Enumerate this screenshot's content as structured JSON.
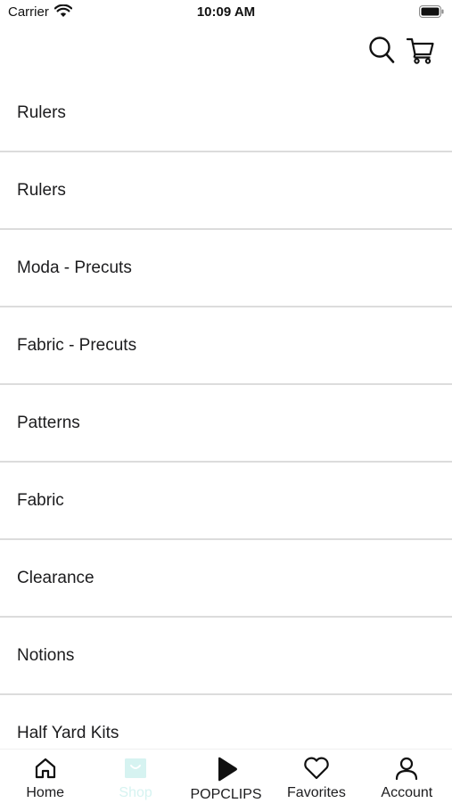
{
  "status_bar": {
    "carrier": "Carrier",
    "time": "10:09 AM"
  },
  "header": {
    "icons": [
      "search-icon",
      "cart-icon"
    ]
  },
  "categories": [
    {
      "label": "Rulers"
    },
    {
      "label": "Rulers"
    },
    {
      "label": "Moda - Precuts"
    },
    {
      "label": "Fabric - Precuts"
    },
    {
      "label": "Patterns"
    },
    {
      "label": "Fabric"
    },
    {
      "label": "Clearance"
    },
    {
      "label": "Notions"
    },
    {
      "label": "Half Yard Kits"
    }
  ],
  "tab_bar": {
    "tabs": [
      {
        "label": "Home",
        "icon": "home-icon"
      },
      {
        "label": "Shop",
        "icon": "shop-icon",
        "active": true
      },
      {
        "label": "POPCLIPS",
        "icon": "play-icon"
      },
      {
        "label": "Favorites",
        "icon": "heart-icon"
      },
      {
        "label": "Account",
        "icon": "account-icon"
      }
    ]
  },
  "colors": {
    "active_tab": "#d6f3f1",
    "text": "#1c1c1e",
    "divider": "#dcdcdc"
  }
}
